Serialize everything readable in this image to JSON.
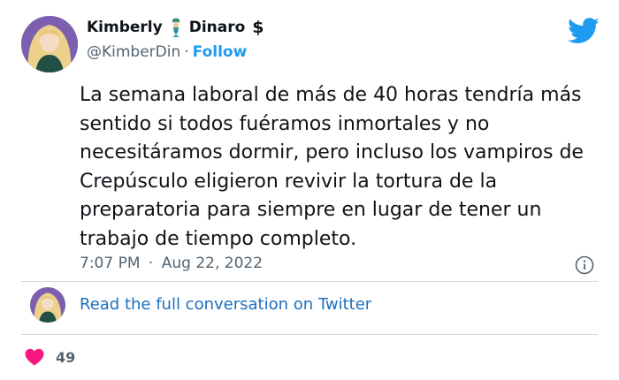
{
  "author": {
    "name_first": "Kimberly",
    "name_last": "Dinaro",
    "dollar_sign": "$",
    "handle": "@KimberDin",
    "separator": "·",
    "follow_label": "Follow"
  },
  "tweet": {
    "text": "La semana laboral de más de 40 horas tendría más sentido si todos fuéramos inmortales y no necesitáramos dormir, pero incluso los vampiros de Crepúsculo eligieron revivir la tortura de la preparatoria para siempre en lugar de tener un trabajo de tiempo completo.",
    "time": "7:07 PM",
    "date": "Aug 22, 2022"
  },
  "read_more_label": "Read the full conversation on Twitter",
  "likes": "49",
  "icons": {
    "brand": "twitter-bird-icon",
    "info": "info-icon",
    "like": "heart-icon",
    "emoji": "mermaid-emoji-icon"
  },
  "colors": {
    "accent": "#1d9bf0",
    "link": "#1d6ec0",
    "heart": "#f91880",
    "muted": "#536471"
  }
}
